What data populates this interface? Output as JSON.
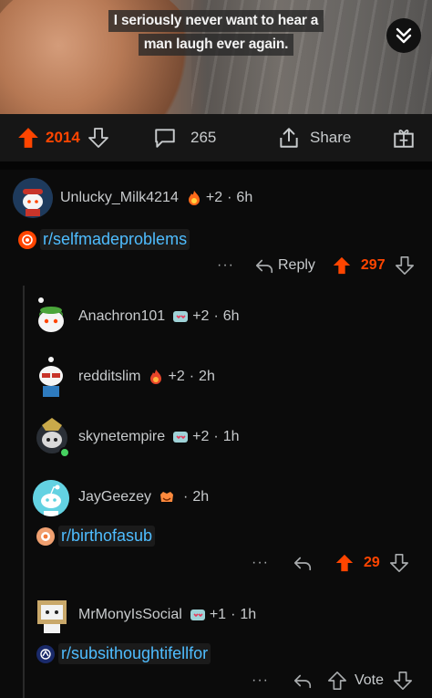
{
  "media": {
    "caption_lines": [
      "I seriously never want to hear a",
      "man laugh ever again."
    ]
  },
  "actionbar": {
    "upvotes": "2014",
    "comments": "265",
    "share_label": "Share"
  },
  "comments": [
    {
      "username": "Unlucky_Milk4214",
      "karma": "+2",
      "age": "6h",
      "flair": "r/selfmadeproblems",
      "reply_label": "Reply",
      "votes": "297",
      "more": "···"
    },
    {
      "username": "Anachron101",
      "karma": "+2",
      "age": "6h"
    },
    {
      "username": "redditslim",
      "karma": "+2",
      "age": "2h"
    },
    {
      "username": "skynetempire",
      "karma": "+2",
      "age": "1h"
    },
    {
      "username": "JayGeezey",
      "age": "2h",
      "flair": "r/birthofasub",
      "votes": "29",
      "more": "···"
    },
    {
      "username": "MrMonyIsSocial",
      "karma": "+1",
      "age": "1h",
      "flair": "r/subsithoughtifellfor",
      "vote_label": "Vote",
      "more": "···"
    }
  ],
  "colors": {
    "accent": "#ff4500",
    "link": "#4fbdff",
    "background": "#0b0b0b",
    "bar": "#161616"
  },
  "icons": [
    "upvote-icon",
    "downvote-icon",
    "comment-icon",
    "share-icon",
    "award-add-icon",
    "collapse-icon",
    "reply-icon"
  ]
}
